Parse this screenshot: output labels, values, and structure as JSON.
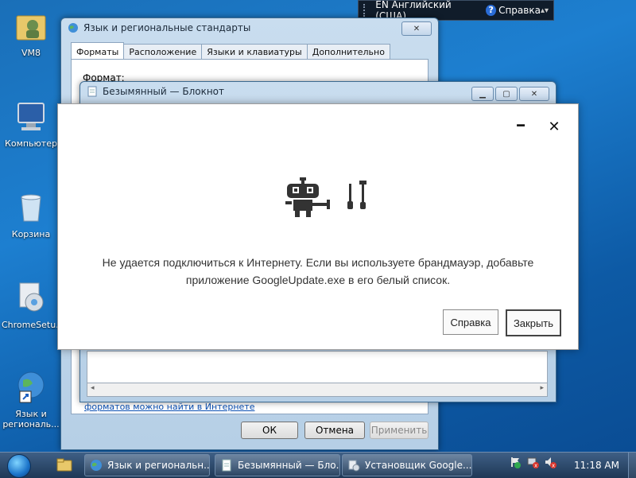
{
  "desktop": {
    "icons": [
      {
        "label": "VM8",
        "icon": "user-folder-icon"
      },
      {
        "label": "Компьютер",
        "icon": "computer-icon"
      },
      {
        "label": "Корзина",
        "icon": "recycle-bin-icon"
      },
      {
        "label": "ChromeSetu...",
        "icon": "installer-icon"
      },
      {
        "label": "Язык и региональ...",
        "icon": "globe-shortcut-icon"
      }
    ]
  },
  "langbar": {
    "language": "EN Английский (США)",
    "help": "Справка"
  },
  "regional_window": {
    "title": "Язык и региональные стандарты",
    "tabs": [
      "Форматы",
      "Расположение",
      "Языки и клавиатуры",
      "Дополнительно"
    ],
    "format_label": "Формат:",
    "link_text": "форматов можно найти в Интернете",
    "buttons": {
      "ok": "ОК",
      "cancel": "Отмена",
      "apply": "Применить"
    }
  },
  "notepad_window": {
    "title": "Безымянный — Блокнот"
  },
  "error_dialog": {
    "message_line1": "Не удается подключиться к Интернету. Если вы используете брандмауэр, добавьте",
    "message_line2": "приложение GoogleUpdate.exe в его белый список.",
    "help_button": "Справка",
    "close_button": "Закрыть"
  },
  "taskbar": {
    "tasks": [
      {
        "label": "Язык и региональн...",
        "icon": "globe-icon"
      },
      {
        "label": "Безымянный — Бло...",
        "icon": "notepad-icon"
      },
      {
        "label": "Установщик Google...",
        "icon": "installer-icon"
      }
    ],
    "clock": "11:18 AM"
  }
}
